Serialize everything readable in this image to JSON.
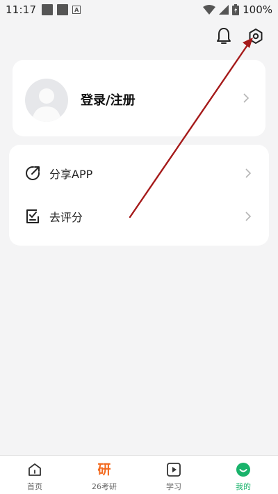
{
  "status_bar": {
    "time": "11:17",
    "battery": "100%"
  },
  "profile": {
    "login_label": "登录/注册"
  },
  "menu": {
    "items": [
      {
        "label": "分享APP",
        "icon": "share-icon"
      },
      {
        "label": "去评分",
        "icon": "rate-icon"
      }
    ]
  },
  "nav": {
    "items": [
      {
        "label": "首页",
        "icon": "home-icon"
      },
      {
        "label": "26考研",
        "icon": "yan-icon",
        "glyph": "研"
      },
      {
        "label": "学习",
        "icon": "play-icon"
      },
      {
        "label": "我的",
        "icon": "smile-icon",
        "active": true
      }
    ]
  },
  "colors": {
    "accent": "#19b36b",
    "exam": "#f36a1f",
    "annotation": "#a51a1a"
  }
}
